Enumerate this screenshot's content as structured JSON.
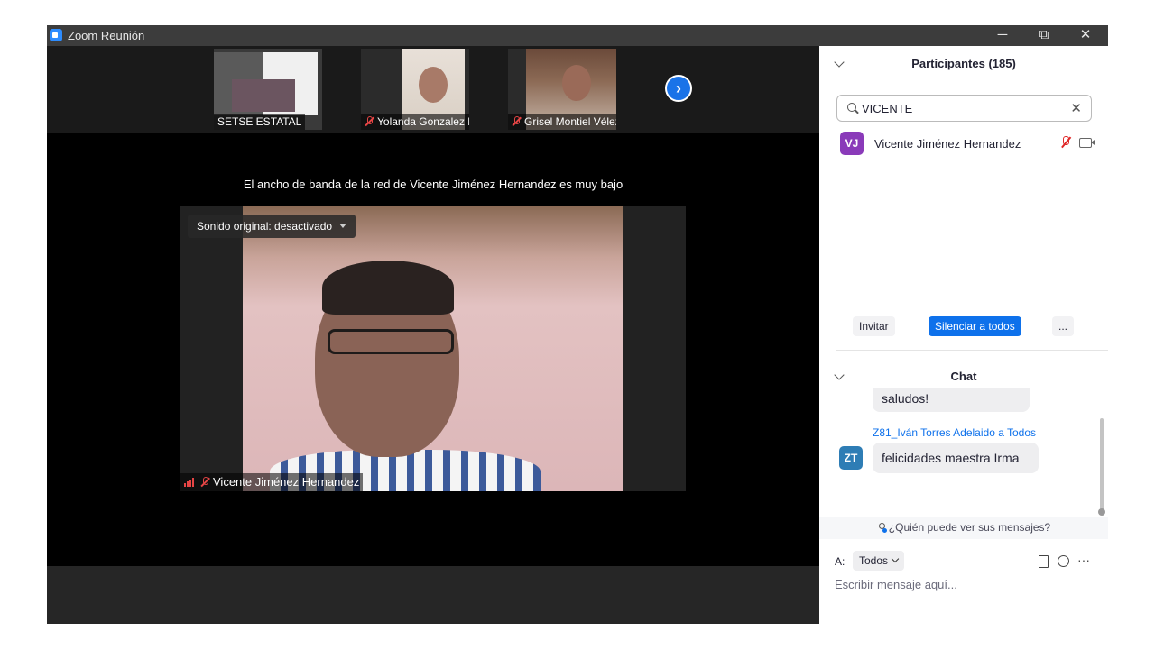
{
  "window": {
    "title": "Zoom Reunión",
    "minimize": "─",
    "restore": "⧉",
    "close": "✕"
  },
  "thumbnails": [
    {
      "name": "SETSE ESTATAL",
      "muted": false
    },
    {
      "name": "Yolanda Gonzalez R",
      "muted": true
    },
    {
      "name": "Grisel Montiel Vélez",
      "muted": true
    }
  ],
  "next_arrow": "›",
  "notice": "El ancho de banda de la red de Vicente Jiménez Hernandez es muy bajo",
  "main_video": {
    "audio_dropdown": "Sonido original: desactivado",
    "speaker": "Vicente Jiménez Hernandez"
  },
  "participants": {
    "header": "Participantes (185)",
    "search_value": "VICENTE",
    "clear": "✕",
    "list": [
      {
        "initials": "VJ",
        "name": "Vicente Jiménez Hernandez",
        "avatar_color": "#8a3ab9"
      }
    ],
    "buttons": {
      "invite": "Invitar",
      "mute_all": "Silenciar a todos",
      "more": "..."
    }
  },
  "chat": {
    "header": "Chat",
    "messages": [
      {
        "text": "saludos!"
      },
      {
        "sender": "Z81_Iván Torres Adelaido a Todos",
        "initials": "ZT",
        "avatar_color": "#2e7db5",
        "text": "felicidades maestra Irma"
      }
    ],
    "who_sees": "¿Quién puede ver sus mensajes?",
    "to_label": "A:",
    "to_value": "Todos",
    "more": "···",
    "input_placeholder": "Escribir mensaje aquí..."
  },
  "colors": {
    "accent": "#0e71eb",
    "muted_red": "#e02828",
    "titlebar": "#3c3c3c"
  }
}
